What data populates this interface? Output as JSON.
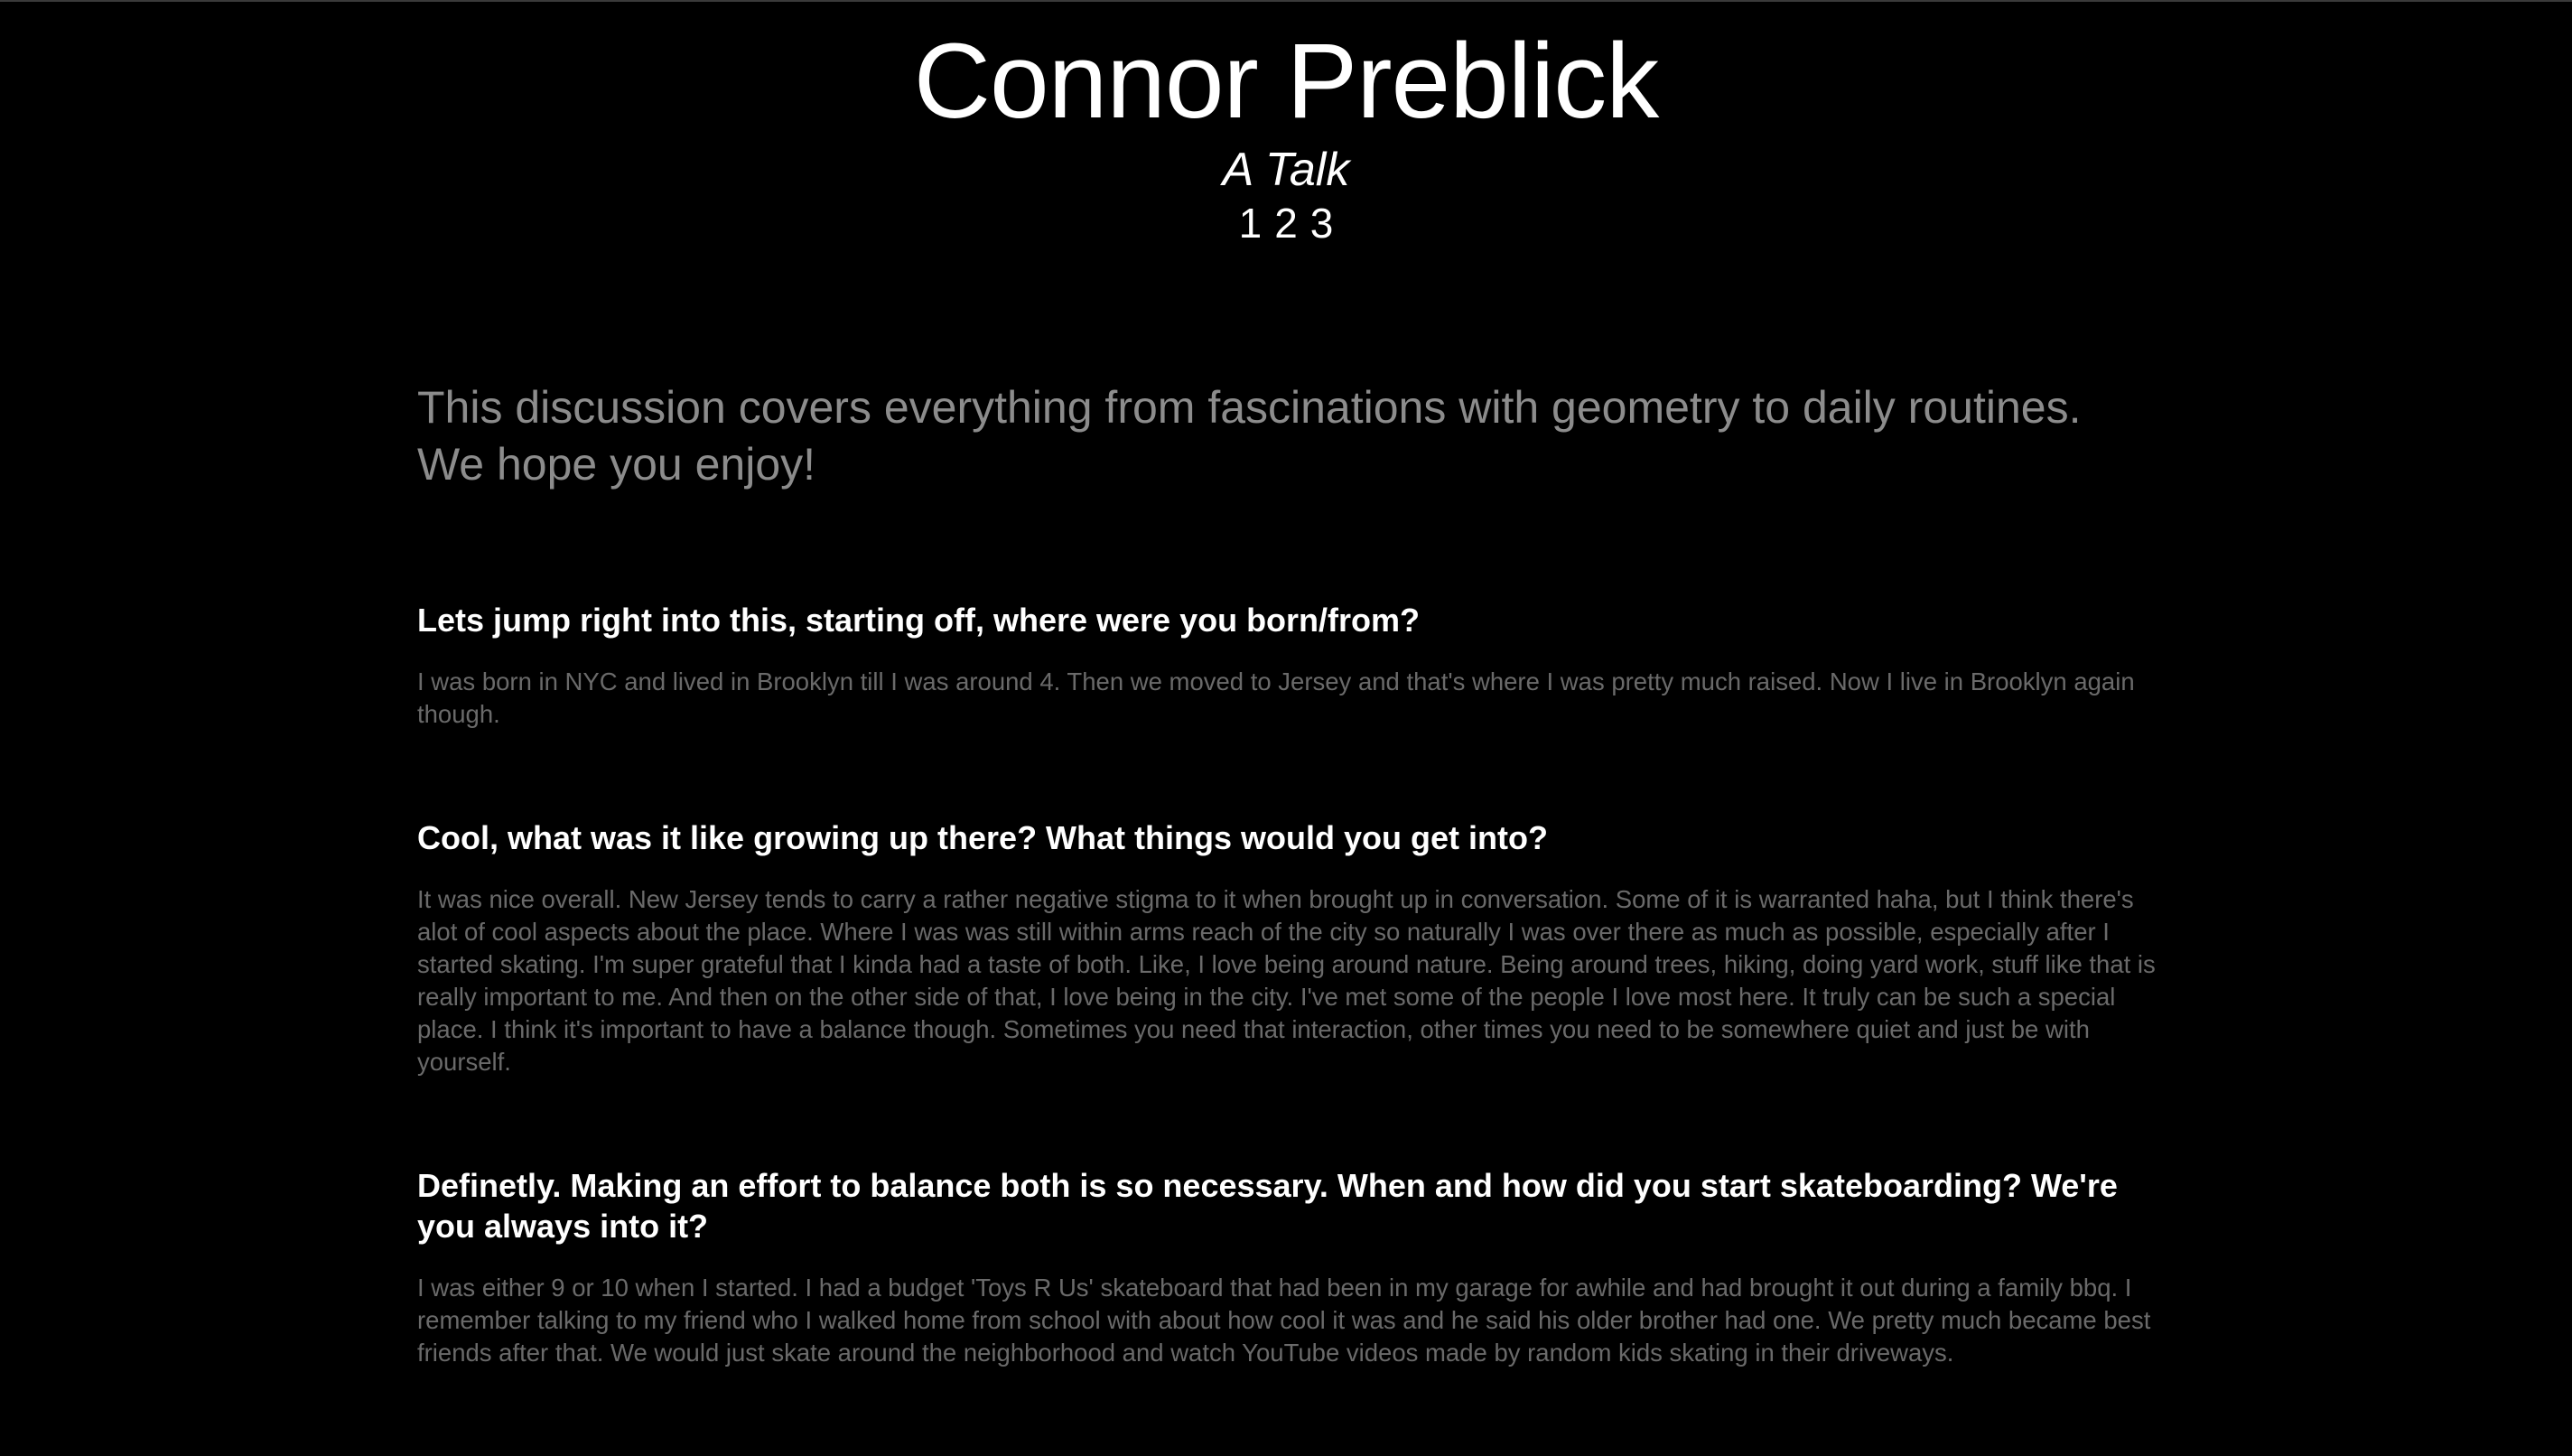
{
  "header": {
    "title": "Connor Preblick",
    "subtitle": "A Talk",
    "pages": [
      "1",
      "2",
      "3"
    ]
  },
  "intro": "This discussion covers everything from fascinations with geometry to daily routines. We hope you enjoy!",
  "qa": [
    {
      "question": "Lets jump right into this, starting off, where were you born/from?",
      "answer": "I was born in NYC and lived in Brooklyn till I was around 4. Then we moved to Jersey and that's where I was pretty much raised. Now I live in Brooklyn again though."
    },
    {
      "question": "Cool, what was it like growing up there? What things would you get into?",
      "answer": "It was nice overall. New Jersey tends to carry a rather negative stigma to it when brought up in conversation. Some of it is warranted haha, but I think there's alot of cool aspects about the place. Where I was was still within arms reach of the city so naturally I was over there as much as possible, especially after I started skating. I'm super grateful that I kinda had a taste of both. Like, I love being around nature. Being around trees, hiking, doing yard work, stuff like that is really important to me. And then on the other side of that, I love being in the city. I've met some of the people I love most here. It truly can be such a special place. I think it's important to have a balance though. Sometimes you need that interaction, other times you need to be somewhere quiet and just be with yourself."
    },
    {
      "question": "Definetly. Making an effort to balance both is so necessary. When and how did you start skateboarding? We're you always into it?",
      "answer": "I was either 9 or 10 when I started. I had a budget 'Toys R Us' skateboard that had been in my garage for awhile and had brought it out during a family bbq. I remember talking to my friend who I walked home from school with about how cool it was and he said his older brother had one. We pretty much became best friends after that. We would just skate around the neighborhood and watch YouTube videos made by random kids skating in their driveways."
    }
  ]
}
